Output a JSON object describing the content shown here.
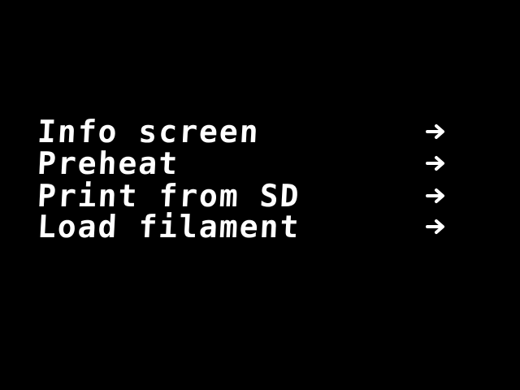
{
  "menu": {
    "items": [
      {
        "label": "Info screen",
        "icon": "arrow-right-icon"
      },
      {
        "label": "Preheat",
        "icon": "arrow-right-icon"
      },
      {
        "label": "Print from SD",
        "icon": "arrow-right-icon"
      },
      {
        "label": "Load filament",
        "icon": "arrow-right-icon"
      }
    ]
  },
  "colors": {
    "background": "#000000",
    "foreground": "#ffffff"
  }
}
